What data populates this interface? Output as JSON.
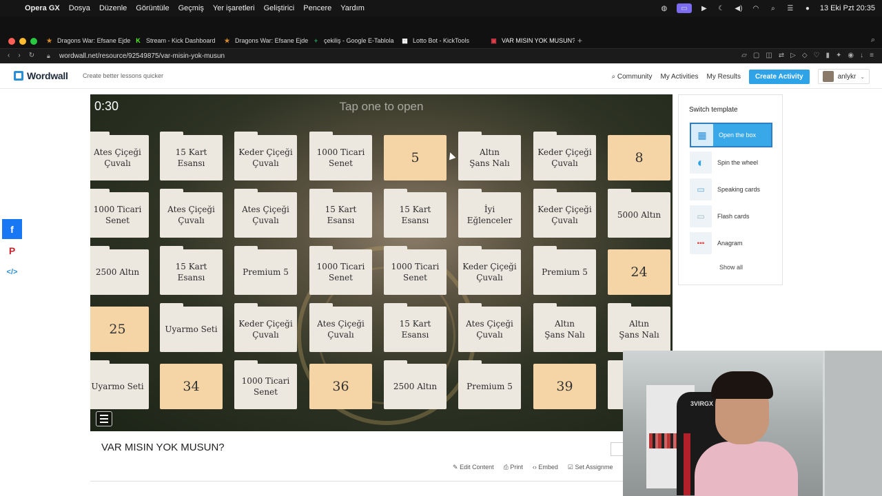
{
  "menubar": {
    "app": "Opera GX",
    "items": [
      "Dosya",
      "Düzenle",
      "Görüntüle",
      "Geçmiş",
      "Yer işaretleri",
      "Geliştirici",
      "Pencere",
      "Yardım"
    ],
    "clock": "13 Eki Pzt  20:35"
  },
  "tabs": [
    {
      "label": "Dragons War: Efsane Ejde",
      "color": "#d98a2b",
      "glyph": "★"
    },
    {
      "label": "Stream - Kick Dashboard",
      "color": "#53fc18",
      "glyph": "K"
    },
    {
      "label": "Dragons War: Efsane Ejde",
      "color": "#d98a2b",
      "glyph": "★"
    },
    {
      "label": "çekiliş - Google E-Tablola",
      "color": "#1fa463",
      "glyph": "+"
    },
    {
      "label": "Lotto Bot - KickTools",
      "color": "#ffffff",
      "glyph": "▦"
    },
    {
      "label": "VAR MISIN YOK MUSUN?",
      "color": "#e33d4c",
      "glyph": "▣"
    }
  ],
  "address": {
    "url": "wordwall.net/resource/92549875/var-misin-yok-musun"
  },
  "header": {
    "brand": "Wordwall",
    "tagline": "Create better lessons quicker",
    "community": "Community",
    "my_activities": "My Activities",
    "my_results": "My Results",
    "create": "Create Activity",
    "username": "anlykr"
  },
  "game": {
    "timer": "0:30",
    "prompt": "Tap one to open",
    "rows": [
      [
        {
          "t": "Ates Çiçeği\nÇuvalı",
          "open": false
        },
        {
          "t": "15 Kart\nEsansı",
          "open": false
        },
        {
          "t": "Keder Çiçeği\nÇuvalı",
          "open": false
        },
        {
          "t": "1000 Ticari\nSenet",
          "open": false
        },
        {
          "t": "5",
          "open": true
        },
        {
          "t": "Altın\nŞans Nalı",
          "open": false
        },
        {
          "t": "Keder Çiçeği\nÇuvalı",
          "open": false
        },
        {
          "t": "8",
          "open": true
        }
      ],
      [
        {
          "t": "1000 Ticari\nSenet",
          "open": false
        },
        {
          "t": "Ates Çiçeği\nÇuvalı",
          "open": false
        },
        {
          "t": "Ates Çiçeği\nÇuvalı",
          "open": false
        },
        {
          "t": "15 Kart\nEsansı",
          "open": false
        },
        {
          "t": "15 Kart\nEsansı",
          "open": false
        },
        {
          "t": "İyi\nEğlenceler",
          "open": false
        },
        {
          "t": "Keder Çiçeği\nÇuvalı",
          "open": false
        },
        {
          "t": "5000 Altın",
          "open": false
        }
      ],
      [
        {
          "t": "2500 Altın",
          "open": false
        },
        {
          "t": "15 Kart\nEsansı",
          "open": false
        },
        {
          "t": "Premium 5",
          "open": false
        },
        {
          "t": "1000 Ticari\nSenet",
          "open": false
        },
        {
          "t": "1000 Ticari\nSenet",
          "open": false
        },
        {
          "t": "Keder Çiçeği\nÇuvalı",
          "open": false
        },
        {
          "t": "Premium 5",
          "open": false
        },
        {
          "t": "24",
          "open": true
        }
      ],
      [
        {
          "t": "25",
          "open": true
        },
        {
          "t": "Uyarmo Seti",
          "open": false
        },
        {
          "t": "Keder Çiçeği\nÇuvalı",
          "open": false
        },
        {
          "t": "Ates Çiçeği\nÇuvalı",
          "open": false
        },
        {
          "t": "15 Kart\nEsansı",
          "open": false
        },
        {
          "t": "Ates Çiçeği\nÇuvalı",
          "open": false
        },
        {
          "t": "Altın\nŞans Nalı",
          "open": false
        },
        {
          "t": "Altın\nŞans Nalı",
          "open": false
        }
      ],
      [
        {
          "t": "Uyarmo Seti",
          "open": false
        },
        {
          "t": "34",
          "open": true
        },
        {
          "t": "1000 Ticari\nSenet",
          "open": false
        },
        {
          "t": "36",
          "open": true
        },
        {
          "t": "2500 Altın",
          "open": false
        },
        {
          "t": "Premium 5",
          "open": false
        },
        {
          "t": "39",
          "open": true
        },
        {
          "t": "Eğ",
          "open": false
        }
      ]
    ]
  },
  "switch_template": {
    "title": "Switch template",
    "items": [
      "Open the box",
      "Spin the wheel",
      "Speaking cards",
      "Flash cards",
      "Anagram"
    ],
    "show_all": "Show all"
  },
  "activity": {
    "title": "VAR MISIN YOK MUSUN?",
    "edit": "Edit Content",
    "print": "Print",
    "embed": "Embed",
    "assign": "Set Assignme"
  },
  "webcam": {
    "chair_brand": "3VIRGX"
  }
}
